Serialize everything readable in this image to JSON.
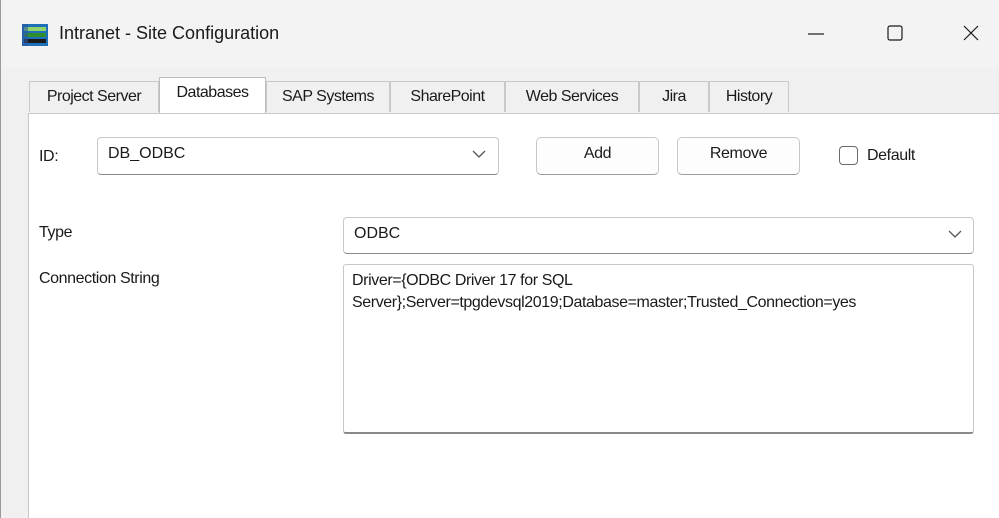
{
  "window": {
    "title": "Intranet - Site Configuration",
    "icon": "database-stack-icon"
  },
  "tabs": [
    {
      "label": "Project Server",
      "active": false
    },
    {
      "label": "Databases",
      "active": true
    },
    {
      "label": "SAP Systems",
      "active": false
    },
    {
      "label": "SharePoint",
      "active": false
    },
    {
      "label": "Web Services",
      "active": false
    },
    {
      "label": "Jira",
      "active": false
    },
    {
      "label": "History",
      "active": false
    }
  ],
  "id_row": {
    "label": "ID:",
    "selected": "DB_ODBC",
    "add_label": "Add",
    "remove_label": "Remove",
    "default_label": "Default",
    "default_checked": false
  },
  "type": {
    "label": "Type",
    "selected": "ODBC"
  },
  "connection": {
    "label": "Connection String",
    "value": "Driver={ODBC Driver 17 for SQL Server};Server=tpgdevsql2019;Database=master;Trusted_Connection=yes"
  },
  "colors": {
    "window_bg": "#f0f0f0",
    "panel_bg": "#ffffff",
    "border": "#c8c8c8"
  }
}
